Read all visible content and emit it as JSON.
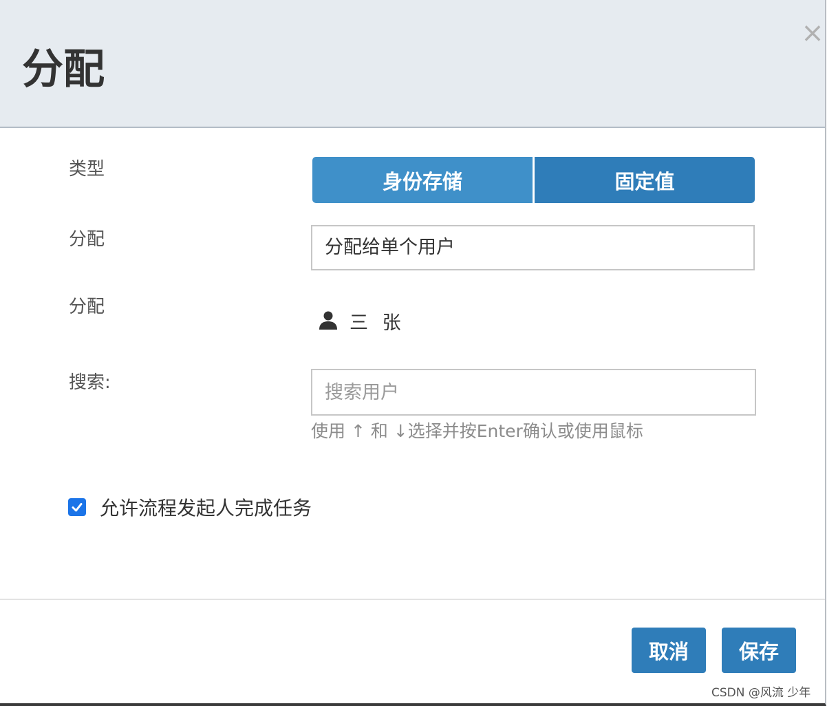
{
  "dialog": {
    "title": "分配",
    "close_symbol": "×"
  },
  "form": {
    "type_label": "类型",
    "type_options": [
      "身份存储",
      "固定值"
    ],
    "assign_label": "分配",
    "assign_select_value": "分配给单个用户",
    "assignee_label": "分配",
    "assignee_name": "三 张",
    "search_label": "搜索:",
    "search_placeholder": "搜索用户",
    "search_help": "使用 ↑ 和 ↓选择并按Enter确认或使用鼠标",
    "allow_initiator_label": "允许流程发起人完成任务",
    "allow_initiator_checked": true
  },
  "footer": {
    "cancel_label": "取消",
    "save_label": "保存"
  },
  "watermark": "CSDN @风流 少年",
  "colors": {
    "header_bg": "#e6ebf0",
    "primary": "#2f7db9",
    "primary_light": "#3f90c9",
    "checkbox": "#1b74e8"
  },
  "icons": {
    "close": "close-icon",
    "user": "user-icon",
    "check": "checkmark-icon"
  }
}
